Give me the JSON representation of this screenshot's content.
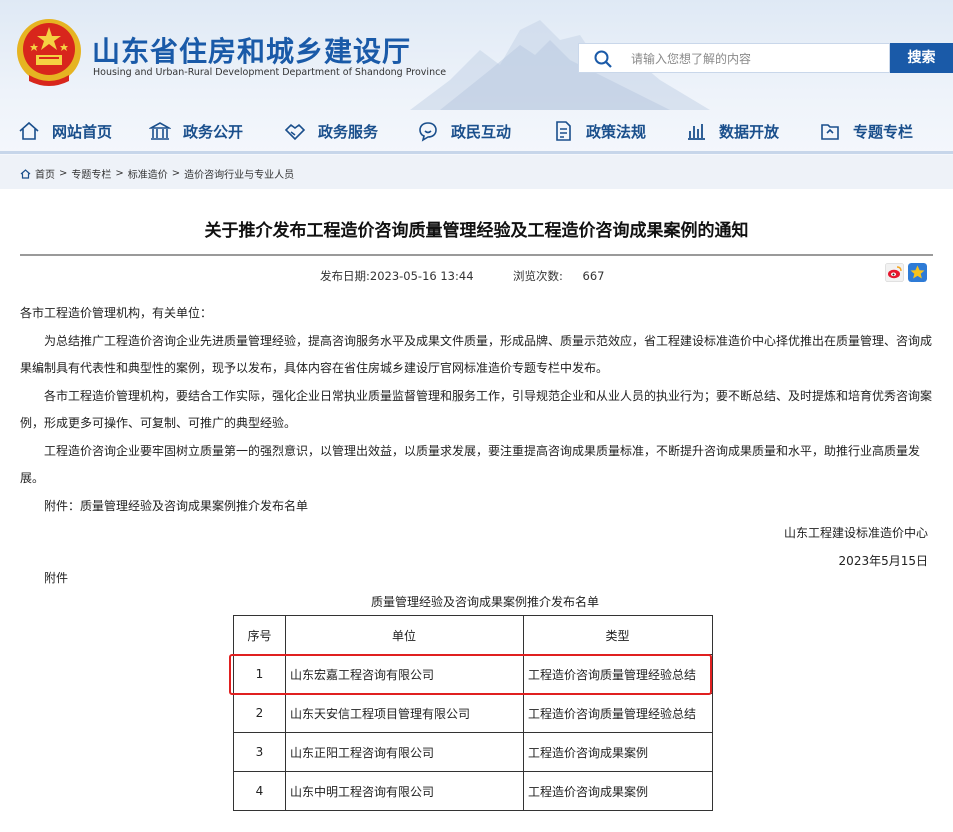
{
  "header": {
    "title": "山东省住房和城乡建设厅",
    "subtitle": "Housing and Urban-Rural Development Department of Shandong Province",
    "search_placeholder": "请输入您想了解的内容",
    "search_button": "搜索"
  },
  "nav": [
    {
      "label": "网站首页",
      "icon": "home-icon"
    },
    {
      "label": "政务公开",
      "icon": "building-icon"
    },
    {
      "label": "政务服务",
      "icon": "handshake-icon"
    },
    {
      "label": "政民互动",
      "icon": "chat-icon"
    },
    {
      "label": "政策法规",
      "icon": "document-icon"
    },
    {
      "label": "数据开放",
      "icon": "bar-chart-icon"
    },
    {
      "label": "专题专栏",
      "icon": "folder-icon"
    }
  ],
  "breadcrumb": [
    "首页",
    "专题专栏",
    "标准造价",
    "造价咨询行业与专业人员"
  ],
  "article": {
    "title": "关于推介发布工程造价咨询质量管理经验及工程造价咨询成果案例的通知",
    "publish_label": "发布日期:",
    "publish_date": "2023-05-16 13:44",
    "views_label": "浏览次数:",
    "views": "667",
    "salutation": "各市工程造价管理机构，有关单位：",
    "paragraphs": [
      "为总结推广工程造价咨询企业先进质量管理经验，提高咨询服务水平及成果文件质量，形成品牌、质量示范效应，省工程建设标准造价中心择优推出在质量管理、咨询成果编制具有代表性和典型性的案例，现予以发布，具体内容在省住房城乡建设厅官网标准造价专题专栏中发布。",
      "各市工程造价管理机构，要结合工作实际，强化企业日常执业质量监督管理和服务工作，引导规范企业和从业人员的执业行为；要不断总结、及时提炼和培育优秀咨询案例，形成更多可操作、可复制、可推广的典型经验。",
      "工程造价咨询企业要牢固树立质量第一的强烈意识，以管理出效益，以质量求发展，要注重提高咨询成果质量标准，不断提升咨询成果质量和水平，助推行业高质量发展。",
      "附件：质量管理经验及咨询成果案例推介发布名单"
    ],
    "signature": "山东工程建设标准造价中心",
    "sign_date": "2023年5月15日",
    "attachment_label": "附件"
  },
  "table": {
    "caption": "质量管理经验及咨询成果案例推介发布名单",
    "headers": [
      "序号",
      "单位",
      "类型"
    ],
    "rows": [
      [
        "1",
        "山东宏嘉工程咨询有限公司",
        "工程造价咨询质量管理经验总结"
      ],
      [
        "2",
        "山东天安信工程项目管理有限公司",
        "工程造价咨询质量管理经验总结"
      ],
      [
        "3",
        "山东正阳工程咨询有限公司",
        "工程造价咨询成果案例"
      ],
      [
        "4",
        "山东中明工程咨询有限公司",
        "工程造价咨询成果案例"
      ]
    ]
  },
  "colors": {
    "brand": "#1a5aa8",
    "highlight": "#e02020"
  }
}
